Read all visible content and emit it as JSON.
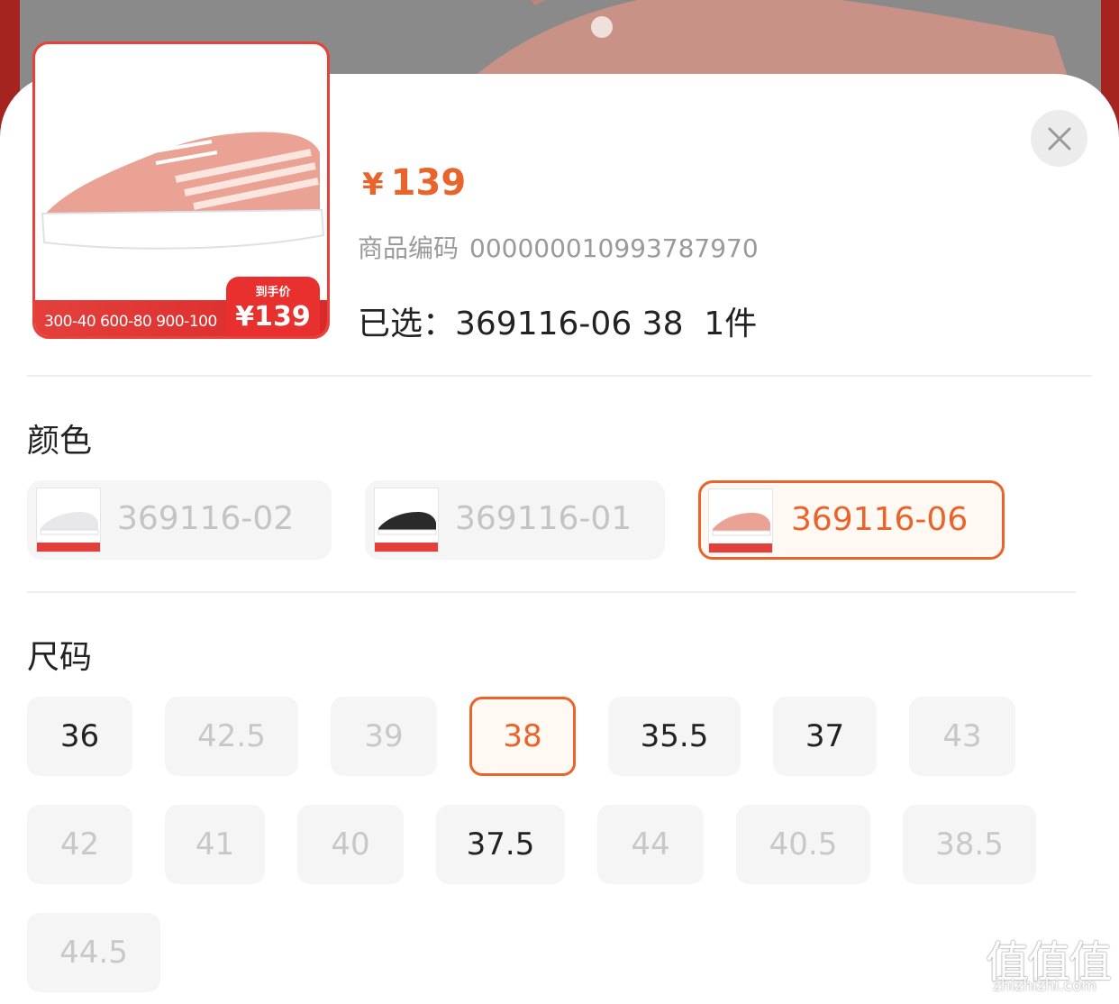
{
  "product": {
    "currency_symbol": "¥",
    "price": "139",
    "code_label": "商品编码",
    "code_value": "000000010993787970",
    "selected_summary": "已选：369116-06 38  1件",
    "image_promo": {
      "thresholds": "300-40 600-80 900-100",
      "tag_label": "到手价",
      "tag_price": "¥139"
    }
  },
  "colors": {
    "title": "颜色",
    "options": [
      {
        "label": "369116-02",
        "swatch": "#e8e8ea",
        "selected": false
      },
      {
        "label": "369116-01",
        "swatch": "#2a2a2a",
        "selected": false
      },
      {
        "label": "369116-06",
        "swatch": "#e9a293",
        "selected": true
      }
    ]
  },
  "sizes": {
    "title": "尺码",
    "options": [
      {
        "label": "36",
        "state": "available"
      },
      {
        "label": "42.5",
        "state": "disabled"
      },
      {
        "label": "39",
        "state": "disabled"
      },
      {
        "label": "38",
        "state": "selected"
      },
      {
        "label": "35.5",
        "state": "available"
      },
      {
        "label": "37",
        "state": "available"
      },
      {
        "label": "43",
        "state": "disabled"
      },
      {
        "label": "42",
        "state": "disabled"
      },
      {
        "label": "41",
        "state": "disabled"
      },
      {
        "label": "40",
        "state": "disabled"
      },
      {
        "label": "37.5",
        "state": "available"
      },
      {
        "label": "44",
        "state": "disabled"
      },
      {
        "label": "40.5",
        "state": "disabled"
      },
      {
        "label": "38.5",
        "state": "disabled"
      },
      {
        "label": "44.5",
        "state": "disabled"
      }
    ]
  },
  "icons": {
    "close": "close-icon"
  },
  "watermark": {
    "glyphs": "值值值",
    "url": "zhizhizhi.com"
  },
  "theme": {
    "accent": "#e8642a",
    "promo_red": "#e3403c"
  }
}
